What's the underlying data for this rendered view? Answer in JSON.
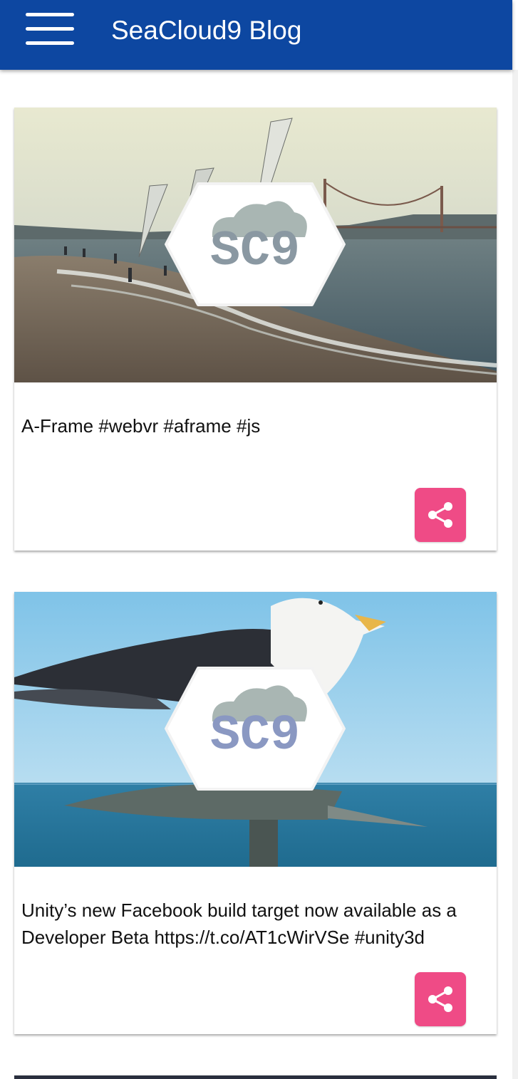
{
  "appbar": {
    "title": "SeaCloud9 Blog",
    "menu_icon": "hamburger-icon",
    "color": "#0d47a1"
  },
  "posts": [
    {
      "text": "A-Frame #webvr #aframe #js",
      "image": "sailboats-on-beach-with-sc9-logo",
      "share_icon": "share-icon"
    },
    {
      "text": "Unity’s new Facebook build target now available as a Developer Beta https://t.co/AT1cWirVSe #unity3d",
      "image": "seagull-on-weathervane-with-sc9-logo",
      "share_icon": "share-icon"
    }
  ],
  "logo": {
    "text": "SC9"
  },
  "accent_color": "#ef4b86"
}
